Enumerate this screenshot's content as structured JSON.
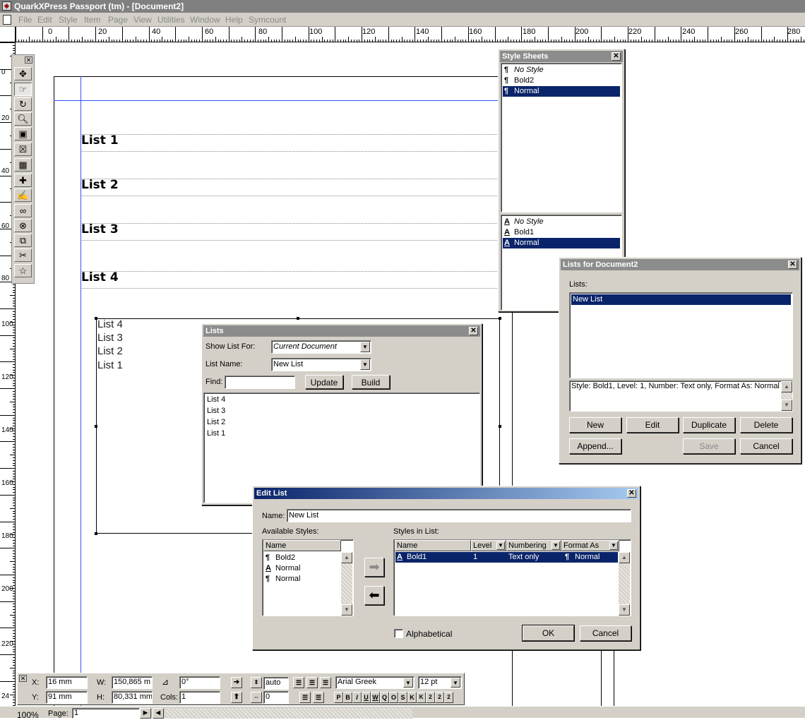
{
  "app": {
    "title": "QuarkXPress Passport (tm) - [Document2]"
  },
  "menu": [
    "File",
    "Edit",
    "Style",
    "Item",
    "Page",
    "View",
    "Utilities",
    "Window",
    "Help",
    "Symcount"
  ],
  "ruler_h": [
    "0",
    "20",
    "40",
    "60",
    "80",
    "100",
    "120",
    "140",
    "160",
    "180",
    "200",
    "220",
    "240",
    "260",
    "280"
  ],
  "ruler_v": [
    "0",
    "20",
    "40",
    "60",
    "80",
    "100",
    "120",
    "140",
    "160",
    "180",
    "200",
    "220",
    "24"
  ],
  "document": {
    "headings": [
      "List 1",
      "List 2",
      "List 3",
      "List 4"
    ],
    "generated_list": [
      "List 4",
      "List 3",
      "List 2",
      "List 1"
    ]
  },
  "style_sheets": {
    "title": "Style Sheets",
    "paragraph": [
      {
        "icon": "¶",
        "name": "No Style"
      },
      {
        "icon": "¶",
        "name": "Bold2"
      },
      {
        "icon": "¶",
        "name": "Normal"
      }
    ],
    "character": [
      {
        "icon": "A",
        "name": "No Style"
      },
      {
        "icon": "A",
        "name": "Bold1"
      },
      {
        "icon": "A",
        "name": "Normal"
      }
    ]
  },
  "lists_palette": {
    "title": "Lists",
    "show_list_for_label": "Show List For:",
    "show_list_for_value": "Current Document",
    "list_name_label": "List Name:",
    "list_name_value": "New List",
    "find_label": "Find:",
    "find_value": "",
    "update_label": "Update",
    "build_label": "Build",
    "items": [
      "List 4",
      "List 3",
      "List 2",
      "List 1"
    ]
  },
  "lists_dialog": {
    "title": "Lists for Document2",
    "lists_label": "Lists:",
    "items": [
      "New List"
    ],
    "info": "Style: Bold1, Level: 1, Number: Text only, Format As: Normal",
    "buttons": {
      "new": "New",
      "edit": "Edit",
      "duplicate": "Duplicate",
      "delete": "Delete",
      "append": "Append...",
      "save": "Save",
      "cancel": "Cancel"
    }
  },
  "edit_list": {
    "title": "Edit List",
    "name_label": "Name:",
    "name_value": "New List",
    "available_label": "Available Styles:",
    "available_header": "Name",
    "available": [
      {
        "icon": "¶",
        "name": "Bold2"
      },
      {
        "icon": "A",
        "name": "Normal"
      },
      {
        "icon": "¶",
        "name": "Normal"
      }
    ],
    "in_list_label": "Styles in List:",
    "columns": {
      "name": "Name",
      "level": "Level",
      "numbering": "Numbering",
      "format_as": "Format As"
    },
    "rows": [
      {
        "icon": "A",
        "name": "Bold1",
        "level": "1",
        "numbering": "Text only",
        "format_icon": "¶",
        "format_as": "Normal"
      }
    ],
    "alphabetical_label": "Alphabetical",
    "ok_label": "OK",
    "cancel_label": "Cancel"
  },
  "measurements": {
    "x_label": "X:",
    "x_value": "16 mm",
    "y_label": "Y:",
    "y_value": "91 mm",
    "w_label": "W:",
    "w_value": "150,865 m",
    "h_label": "H:",
    "h_value": "80,331 mm",
    "angle_value": "0°",
    "cols_label": "Cols:",
    "cols_value": "1",
    "leading_value": "auto",
    "tracking_value": "0",
    "font_value": "Arial Greek",
    "size_value": "12 pt",
    "style_buttons": [
      "P",
      "B",
      "I",
      "U",
      "W",
      "Q",
      "O",
      "S",
      "K",
      "K",
      "2",
      "2",
      "2"
    ]
  },
  "status": {
    "zoom": "100%",
    "page_label": "Page:",
    "page_value": "1"
  }
}
